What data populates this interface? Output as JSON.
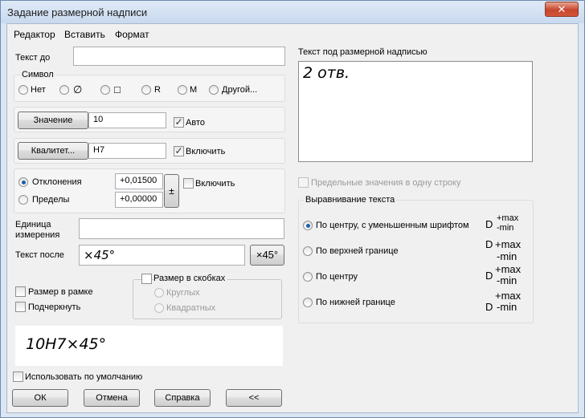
{
  "window": {
    "title": "Задание размерной надписи",
    "close_glyph": "✕"
  },
  "menu": {
    "editor": "Редактор",
    "insert": "Вставить",
    "format": "Формат"
  },
  "text_before": {
    "label": "Текст до",
    "value": ""
  },
  "symbol": {
    "group_label": "Символ",
    "options": [
      "Нет",
      "∅",
      "□",
      "R",
      "M",
      "Другой..."
    ]
  },
  "value": {
    "button": "Значение",
    "field": "10",
    "auto_label": "Авто",
    "auto_checked": true
  },
  "quality": {
    "button": "Квалитет...",
    "field": "H7",
    "include_label": "Включить",
    "include_checked": true
  },
  "deviations": {
    "radio_deviations": "Отклонения",
    "radio_limits": "Пределы",
    "upper": "+0,01500",
    "lower": "+0,00000",
    "pm_button": "±",
    "include_label": "Включить"
  },
  "unit": {
    "label_line1": "Единица",
    "label_line2": "измерения",
    "value": ""
  },
  "text_after": {
    "label": "Текст после",
    "value": "×45°",
    "button": "×45°"
  },
  "options": {
    "framed": "Размер в рамке",
    "underline": "Подчеркнуть",
    "in_brackets": "Размер в скобках",
    "round": "Круглых",
    "square": "Квадратных"
  },
  "preview": {
    "text": "10H7×45°"
  },
  "use_default": "Использовать по умолчанию",
  "buttons": {
    "ok": "ОК",
    "cancel": "Отмена",
    "help": "Справка",
    "collapse": "<<"
  },
  "text_under": {
    "label": "Текст под размерной надписью",
    "value": "2 отв."
  },
  "limits_one_line": "Предельные значения в одну строку",
  "alignment": {
    "group_label": "Выравнивание текста",
    "items": [
      {
        "label": "По центру, с уменьшенным шрифтом",
        "selected": true
      },
      {
        "label": "По верхней границе",
        "selected": false
      },
      {
        "label": "По центру",
        "selected": false
      },
      {
        "label": "По нижней границе",
        "selected": false
      }
    ],
    "sym_d": "D",
    "sym_max": "+max",
    "sym_min": "-min"
  }
}
